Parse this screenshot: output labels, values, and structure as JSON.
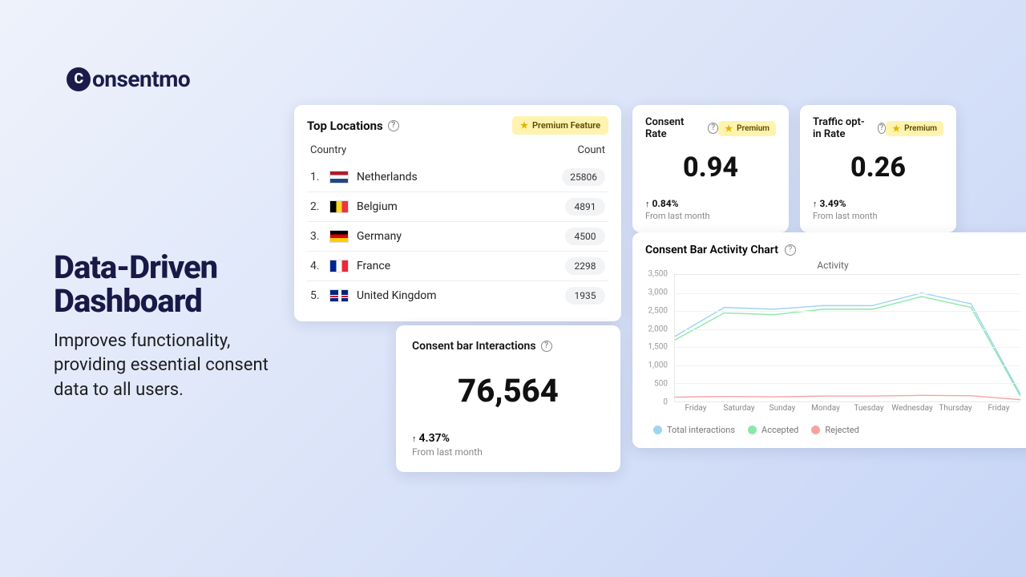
{
  "brand": {
    "name": "onsentmo",
    "mark": "C"
  },
  "hero": {
    "title": "Data-Driven Dashboard",
    "body": "Improves functionality, providing essential consent data to all users."
  },
  "top_locations": {
    "title": "Top Locations",
    "premium_label": "Premium Feature",
    "col_country": "Country",
    "col_count": "Count",
    "rows": [
      {
        "idx": "1.",
        "flag": "flag-nl",
        "name": "Netherlands",
        "count": "25806"
      },
      {
        "idx": "2.",
        "flag": "flag-be",
        "name": "Belgium",
        "count": "4891"
      },
      {
        "idx": "3.",
        "flag": "flag-de",
        "name": "Germany",
        "count": "4500"
      },
      {
        "idx": "4.",
        "flag": "flag-fr",
        "name": "France",
        "count": "2298"
      },
      {
        "idx": "5.",
        "flag": "flag-uk",
        "name": "United Kingdom",
        "count": "1935"
      }
    ]
  },
  "consent_rate": {
    "title": "Consent Rate",
    "badge": "Premium",
    "value": "0.94",
    "delta": "0.84%",
    "sub": "From last month"
  },
  "traffic_rate": {
    "title": "Traffic opt-in Rate",
    "badge": "Premium",
    "value": "0.26",
    "delta": "3.49%",
    "sub": "From last month"
  },
  "interactions": {
    "title": "Consent bar Interactions",
    "value": "76,564",
    "delta": "4.37%",
    "sub": "From last month"
  },
  "activity_chart": {
    "title": "Consent Bar Activity Chart",
    "caption": "Activity",
    "legend": {
      "total": "Total interactions",
      "accepted": "Accepted",
      "rejected": "Rejected"
    }
  },
  "colors": {
    "total": "#9ed3f3",
    "accepted": "#8be7a8",
    "rejected": "#f5a3a3"
  },
  "chart_data": {
    "type": "line",
    "title": "Activity",
    "xlabel": "",
    "ylabel": "",
    "ylim": [
      0,
      3500
    ],
    "y_ticks": [
      "3,500",
      "3,000",
      "2,500",
      "2,000",
      "1,500",
      "1,000",
      "500",
      "0"
    ],
    "categories": [
      "Friday",
      "Saturday",
      "Sunday",
      "Monday",
      "Tuesday",
      "Wednesday",
      "Thursday",
      "Friday"
    ],
    "series": [
      {
        "name": "Total interactions",
        "color": "#9ed3f3",
        "values": [
          1800,
          2600,
          2550,
          2650,
          2650,
          3000,
          2700,
          200
        ]
      },
      {
        "name": "Accepted",
        "color": "#8be7a8",
        "values": [
          1700,
          2450,
          2400,
          2550,
          2550,
          2900,
          2600,
          150
        ]
      },
      {
        "name": "Rejected",
        "color": "#f5a3a3",
        "values": [
          120,
          140,
          130,
          150,
          150,
          170,
          160,
          50
        ]
      }
    ]
  }
}
